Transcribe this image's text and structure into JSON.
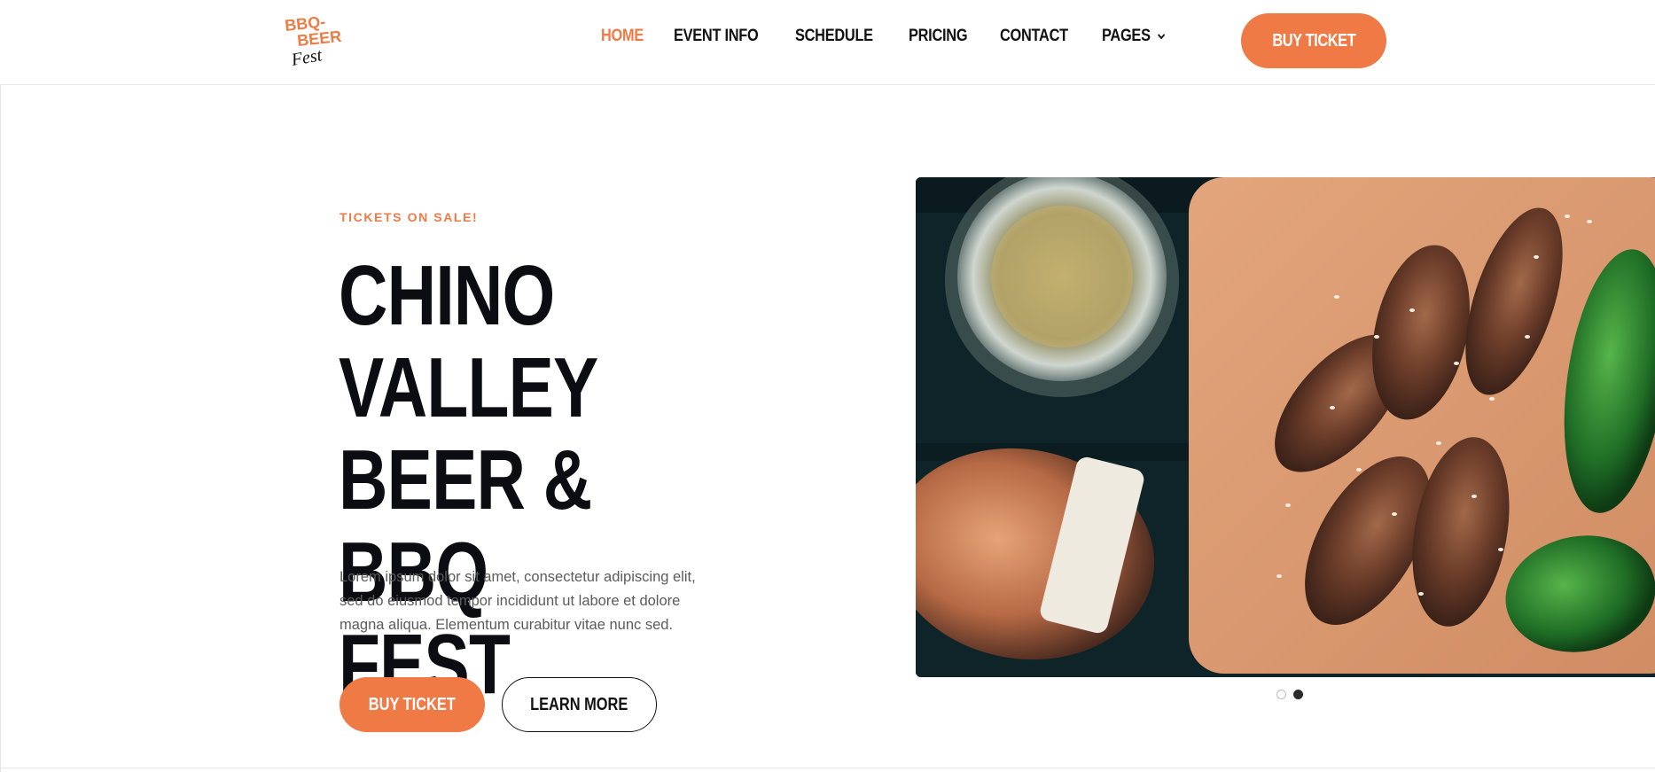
{
  "brand": {
    "logo_line1": "BBQ-",
    "logo_line2": "BEER",
    "logo_line3": "Fest",
    "accent": "#f07a45",
    "dark": "#0c0d13"
  },
  "nav": {
    "items": [
      {
        "label": "HOME",
        "active": true
      },
      {
        "label": "EVENT INFO",
        "active": false
      },
      {
        "label": "SCHEDULE",
        "active": false
      },
      {
        "label": "PRICING",
        "active": false
      },
      {
        "label": "CONTACT",
        "active": false
      },
      {
        "label": "PAGES",
        "active": false,
        "icon": "chevron-down-icon"
      }
    ],
    "cta_label": "BUY TICKET"
  },
  "hero": {
    "kicker": "TICKETS ON SALE!",
    "title_line1": "CHINO VALLEY",
    "title_line2": "BEER & BBQ",
    "title_line3": "FEST",
    "text_line1": "Lorem ipsum dolor sit amet, consectetur adipiscing elit,",
    "text_line2": "sed do eiusmod tempor incididunt ut labore et dolore",
    "text_line3": "magna aliqua. Elementum curabitur vitae nunc sed.",
    "primary_label": "BUY TICKET",
    "secondary_label": "LEARN MORE"
  },
  "slider": {
    "slide_count": 2,
    "active_index": 1
  }
}
